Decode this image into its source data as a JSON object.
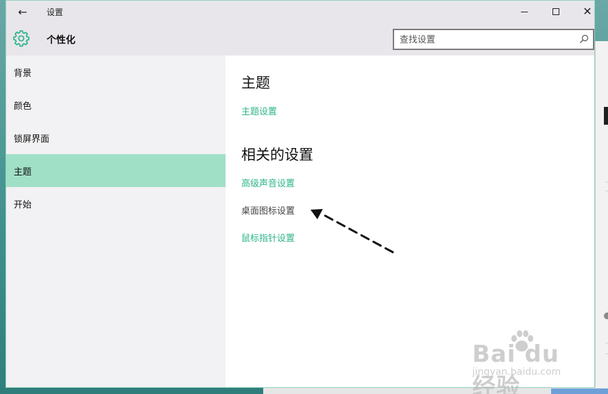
{
  "titlebar": {
    "title": "设置",
    "back_icon": "←",
    "close_icon": "✕"
  },
  "header": {
    "title": "个性化",
    "icon": "gear-icon"
  },
  "search": {
    "placeholder": "查找设置",
    "value": ""
  },
  "sidebar": {
    "items": [
      {
        "label": "背景",
        "selected": false
      },
      {
        "label": "颜色",
        "selected": false
      },
      {
        "label": "锁屏界面",
        "selected": false
      },
      {
        "label": "主题",
        "selected": true
      },
      {
        "label": "开始",
        "selected": false
      }
    ]
  },
  "content": {
    "theme_heading": "主题",
    "theme_settings_link": "主题设置",
    "related_heading": "相关的设置",
    "related_links": [
      "高级声音设置",
      "桌面图标设置",
      "鼠标指针设置"
    ]
  },
  "watermark": {
    "logo": "Bai du 经验",
    "url": "jingyan.baidu.com"
  },
  "colors": {
    "accent": "#2db48a",
    "selected_bg": "#9fe0c6",
    "sidebar_bg": "#f2f1f3",
    "header_bg": "#e8e6ea"
  }
}
